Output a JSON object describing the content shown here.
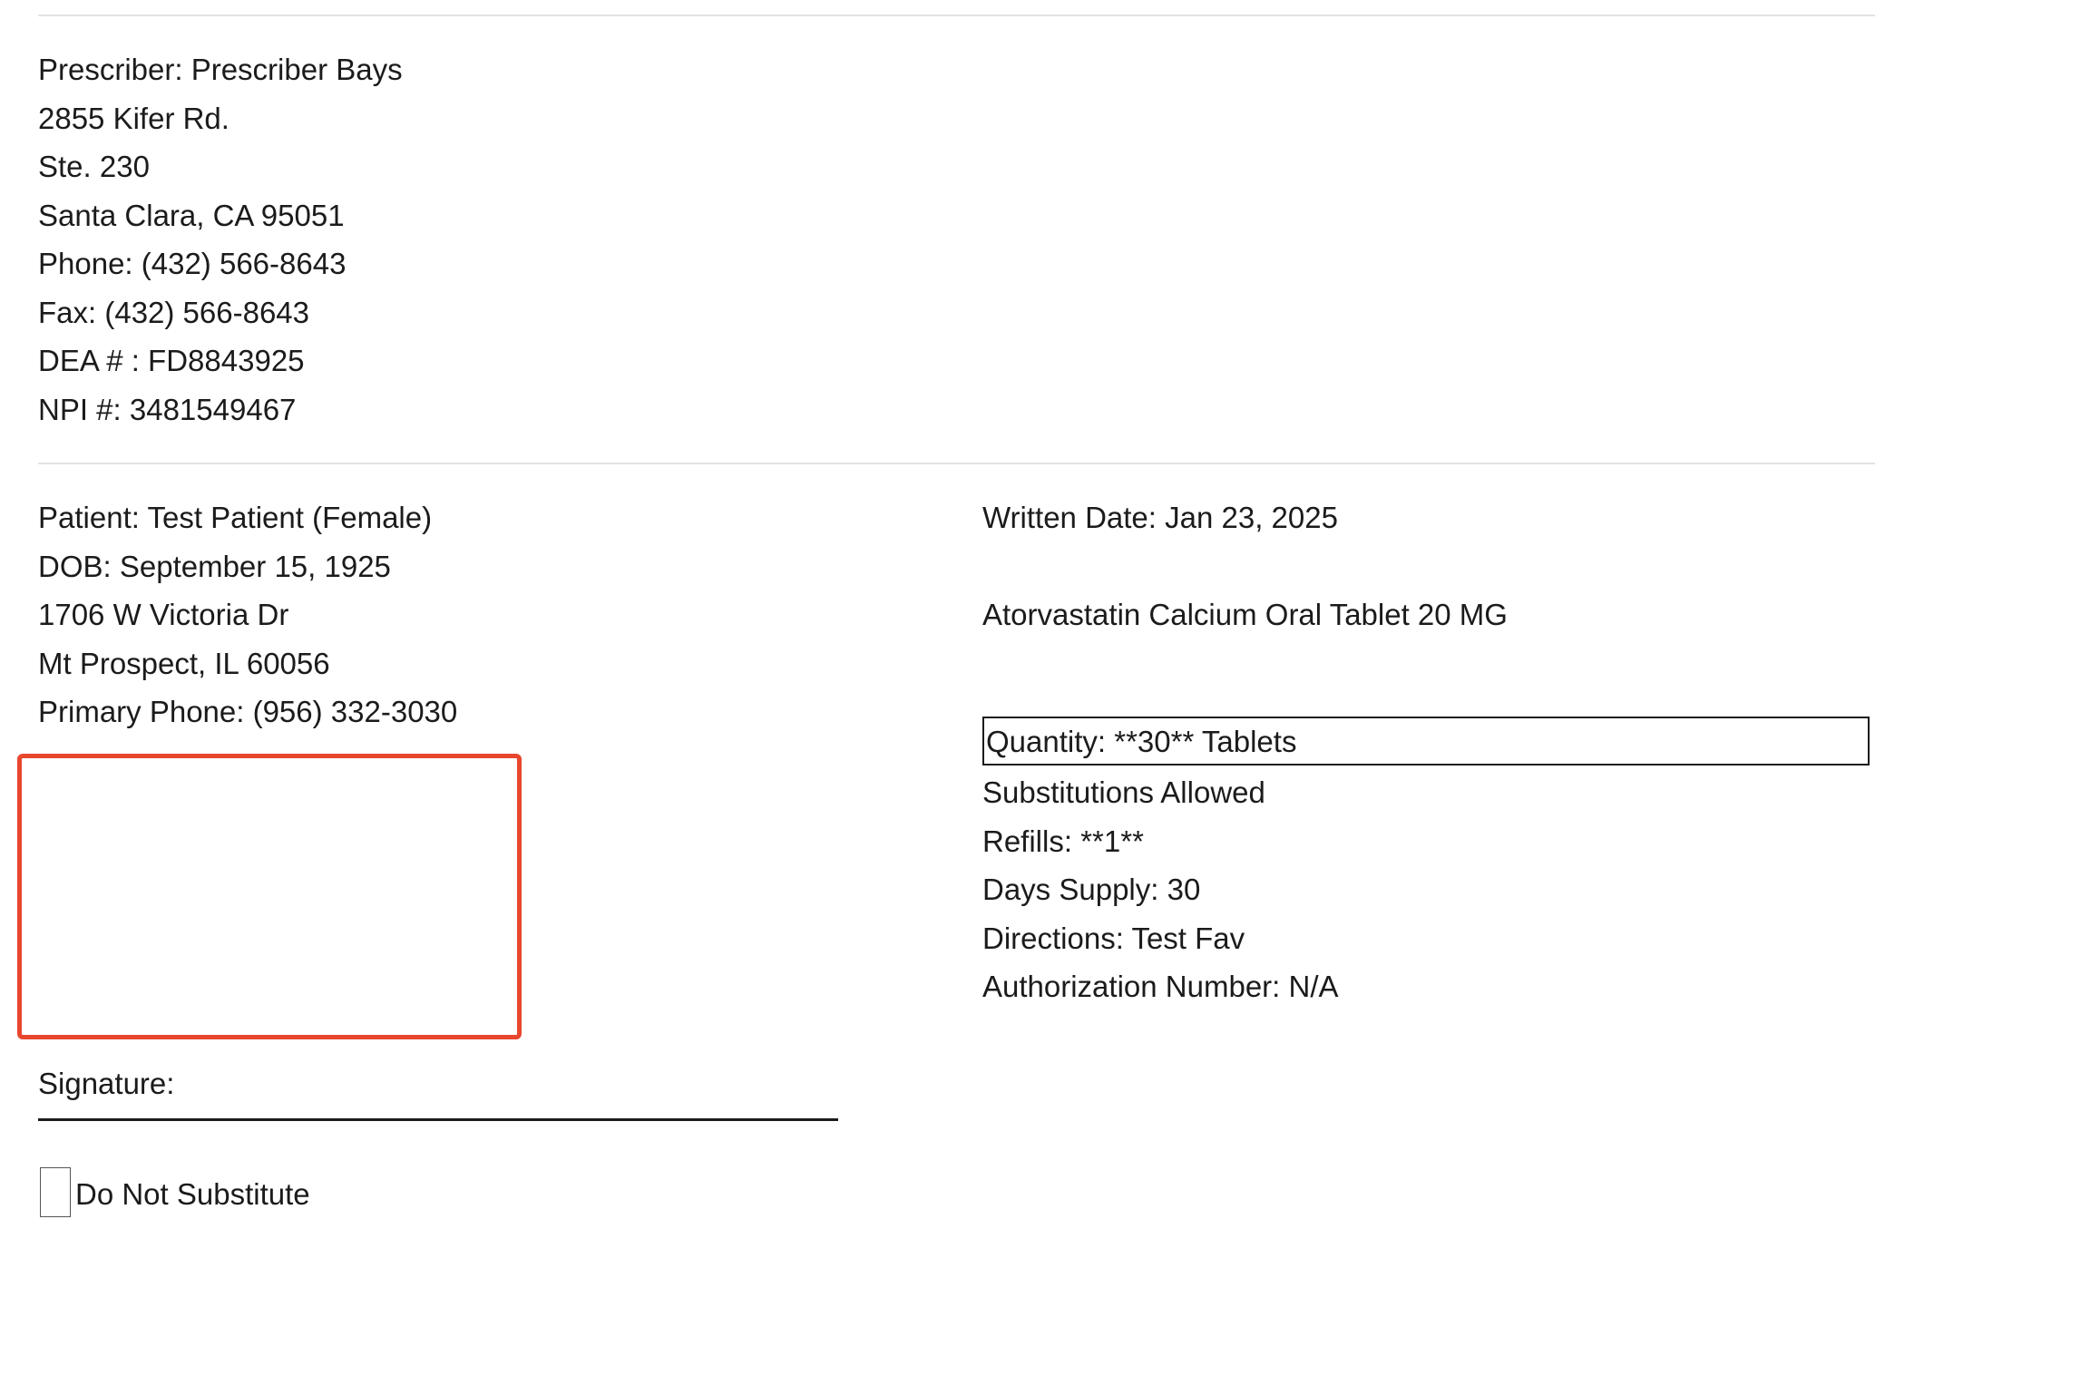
{
  "prescriber": {
    "name_line": "Prescriber: Prescriber Bays",
    "address1": "2855 Kifer Rd.",
    "address2": "Ste. 230",
    "city_state_zip": "Santa Clara, CA 95051",
    "phone": "Phone: (432) 566-8643",
    "fax": "Fax: (432) 566-8643",
    "dea": "DEA # : FD8843925",
    "npi": "NPI #: 3481549467"
  },
  "patient": {
    "name_line": "Patient: Test Patient (Female)",
    "dob": "DOB: September 15, 1925",
    "address1": "1706 W Victoria Dr",
    "city_state_zip": "Mt Prospect, IL 60056",
    "primary_phone": "Primary Phone: (956) 332-3030"
  },
  "prescription": {
    "written_date": "Written Date: Jan 23, 2025",
    "drug": "Atorvastatin Calcium Oral Tablet 20 MG",
    "quantity": "Quantity: **30** Tablets",
    "substitutions": "Substitutions Allowed",
    "refills": "Refills: **1**",
    "days_supply": "Days Supply: 30",
    "directions": "Directions: Test Fav",
    "authorization": "Authorization Number: N/A"
  },
  "signature": {
    "label": "Signature:"
  },
  "do_not_substitute": {
    "label": "Do Not Substitute",
    "checked": false
  },
  "colors": {
    "highlight_border": "#e8472e",
    "text": "#1b1b1b",
    "rule": "#e3e3e3"
  }
}
